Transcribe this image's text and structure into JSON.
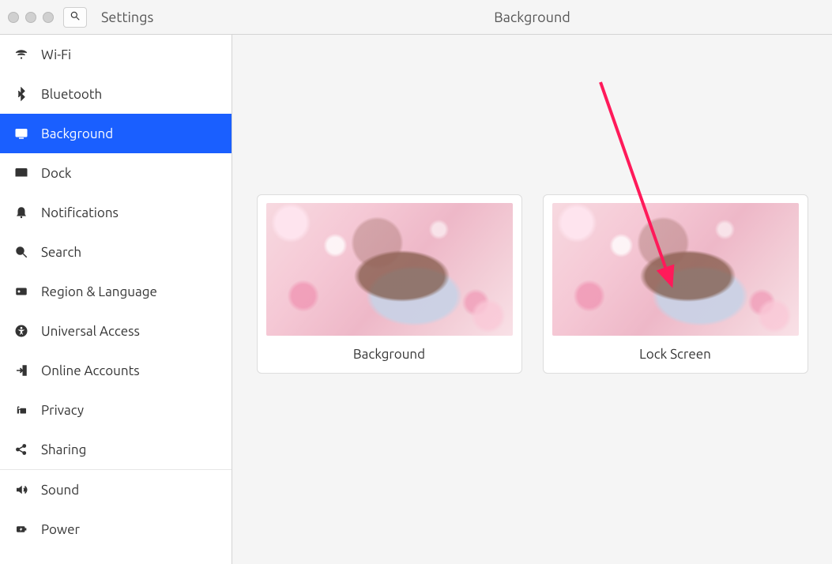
{
  "header": {
    "app_title": "Settings",
    "page_title": "Background"
  },
  "sidebar": {
    "items": [
      {
        "icon": "wifi",
        "label": "Wi-Fi",
        "active": false
      },
      {
        "icon": "bluetooth",
        "label": "Bluetooth",
        "active": false
      },
      {
        "icon": "background",
        "label": "Background",
        "active": true
      },
      {
        "icon": "dock",
        "label": "Dock",
        "active": false
      },
      {
        "icon": "notifications",
        "label": "Notifications",
        "active": false
      },
      {
        "icon": "search",
        "label": "Search",
        "active": false
      },
      {
        "icon": "region",
        "label": "Region & Language",
        "active": false
      },
      {
        "icon": "universal",
        "label": "Universal Access",
        "active": false
      },
      {
        "icon": "online",
        "label": "Online Accounts",
        "active": false
      },
      {
        "icon": "privacy",
        "label": "Privacy",
        "active": false
      },
      {
        "icon": "sharing",
        "label": "Sharing",
        "active": false
      },
      {
        "icon": "sound",
        "label": "Sound",
        "active": false,
        "separator_before": true
      },
      {
        "icon": "power",
        "label": "Power",
        "active": false
      }
    ]
  },
  "main": {
    "cards": [
      {
        "caption": "Background"
      },
      {
        "caption": "Lock Screen"
      }
    ]
  },
  "annotation": {
    "type": "arrow",
    "color": "#ff1a5a"
  }
}
